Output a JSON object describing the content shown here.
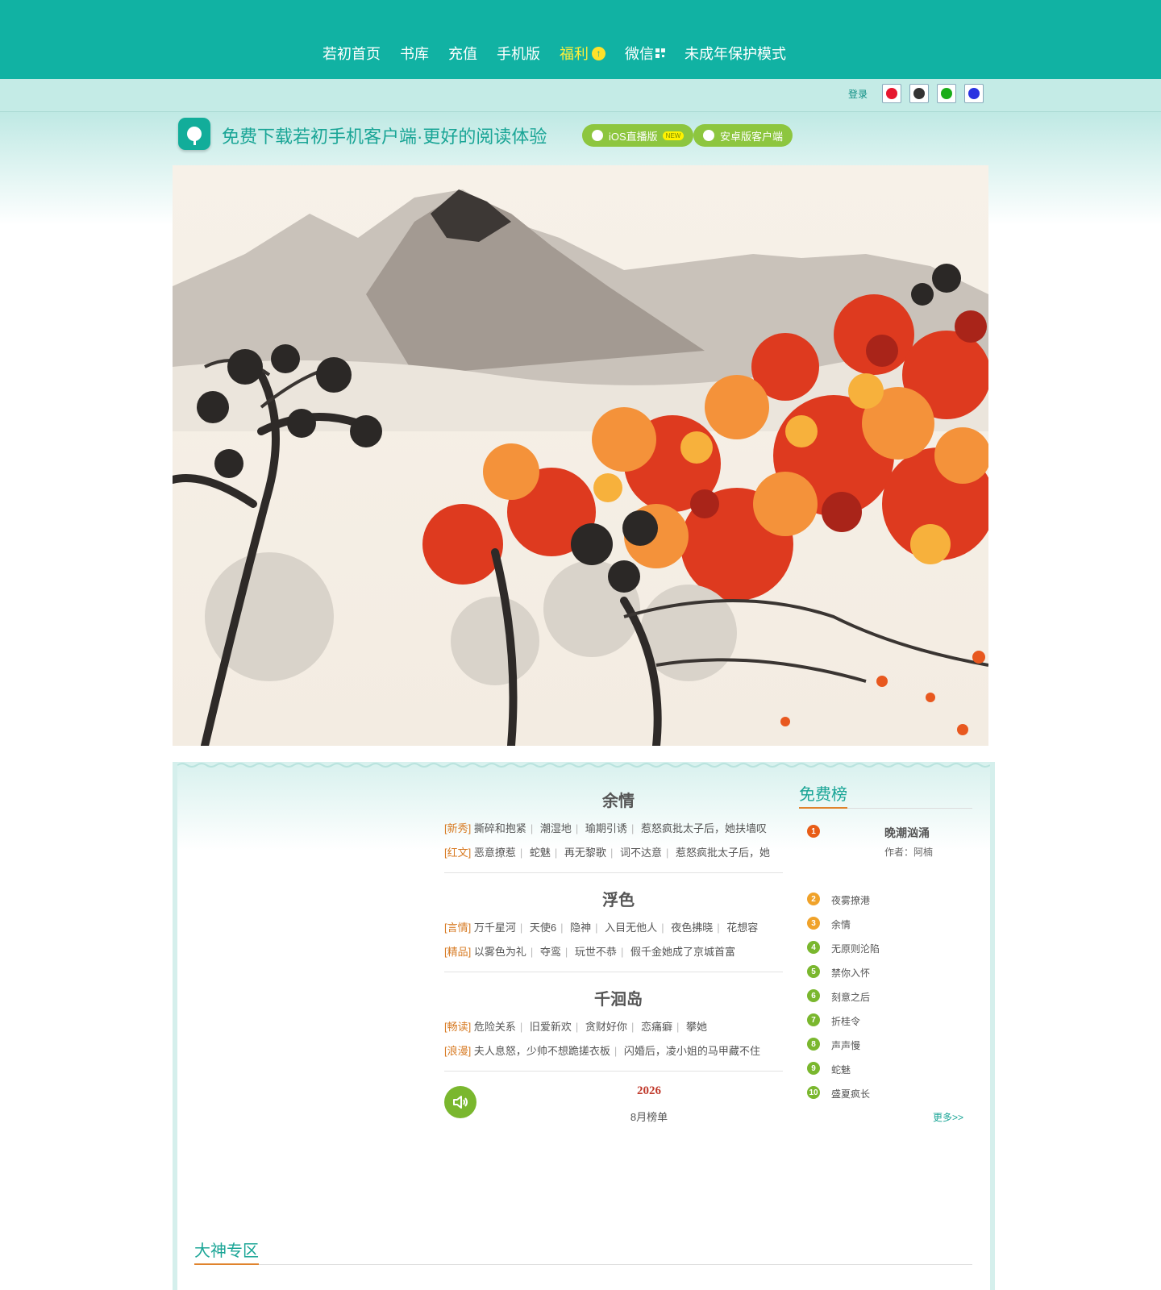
{
  "nav": {
    "items": [
      {
        "label": "若初首页",
        "hot": false
      },
      {
        "label": "书库",
        "hot": false
      },
      {
        "label": "充值",
        "hot": false
      },
      {
        "label": "手机版",
        "hot": false
      },
      {
        "label": "福利",
        "hot": true,
        "icon": "up-arrow-icon"
      },
      {
        "label": "微信",
        "hot": false,
        "icon": "qr-code-icon"
      },
      {
        "label": "未成年保护模式",
        "hot": false
      }
    ]
  },
  "login": {
    "label": "登录",
    "socials": [
      {
        "icon": "weibo-icon",
        "color": "#e6162d"
      },
      {
        "icon": "qq-icon",
        "color": "#333333"
      },
      {
        "icon": "wechat-icon",
        "color": "#1aad19"
      },
      {
        "icon": "baidu-icon",
        "color": "#2932e1"
      }
    ]
  },
  "download": {
    "title": "免费下载若初手机客户端·更好的阅读体验",
    "ios_label": "iOS直播版",
    "ios_badge": "NEW",
    "android_label": "安卓版客户端"
  },
  "colors": {
    "brand": "#11b2a3",
    "accent": "#8dc63f",
    "tag": "#d77a22"
  },
  "recommend": [
    {
      "title": "余情",
      "rows": [
        {
          "tag": "[新秀]",
          "books": [
            "撕碎和抱紧",
            "潮湿地",
            "瑜期引诱",
            "惹怒疯批太子后，她扶墙叹"
          ]
        },
        {
          "tag": "[红文]",
          "books": [
            "恶意撩惹",
            "蛇魅",
            "再无黎歌",
            "词不达意",
            "惹怒疯批太子后，她"
          ]
        }
      ]
    },
    {
      "title": "浮色",
      "rows": [
        {
          "tag": "[言情]",
          "books": [
            "万千星河",
            "天使6",
            "隐神",
            "入目无他人",
            "夜色拂晓",
            "花想容"
          ]
        },
        {
          "tag": "[精品]",
          "books": [
            "以雾色为礼",
            "夺鸾",
            "玩世不恭",
            "假千金她成了京城首富"
          ]
        }
      ]
    },
    {
      "title": "千洄岛",
      "rows": [
        {
          "tag": "[畅读]",
          "books": [
            "危险关系",
            "旧爱新欢",
            "贪财好你",
            "恋痛癖",
            "攀她"
          ]
        },
        {
          "tag": "[浪漫]",
          "books": [
            "夫人息怒，少帅不想跪搓衣板",
            "闪婚后，凌小姐的马甲藏不住"
          ]
        }
      ]
    }
  ],
  "monthly": {
    "year": "2026",
    "label": "8月榜单",
    "icon": "speaker-icon"
  },
  "free_rank": {
    "title": "免费榜",
    "top": {
      "num": "1",
      "name": "晚潮汹涌",
      "author": "作者：阿楠"
    },
    "items": [
      {
        "num": "2",
        "name": "夜雾撩港"
      },
      {
        "num": "3",
        "name": "余情"
      },
      {
        "num": "4",
        "name": "无原则沦陷"
      },
      {
        "num": "5",
        "name": "禁你入怀"
      },
      {
        "num": "6",
        "name": "刻意之后"
      },
      {
        "num": "7",
        "name": "折桂令"
      },
      {
        "num": "8",
        "name": "声声慢"
      },
      {
        "num": "9",
        "name": "蛇魅"
      },
      {
        "num": "10",
        "name": "盛夏疯长"
      }
    ],
    "more": "更多>>"
  },
  "section": {
    "title": "大神专区"
  }
}
